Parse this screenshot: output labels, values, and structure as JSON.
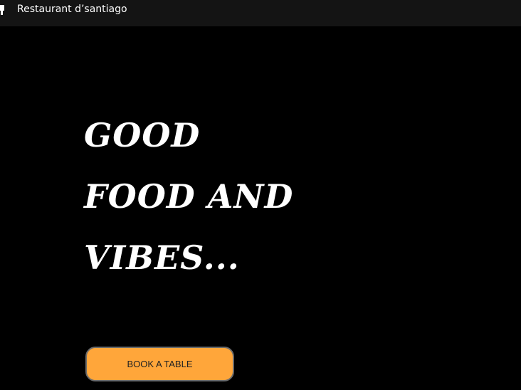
{
  "window": {
    "title": "Restaurant d’santiago",
    "icon": "chef-hat-icon"
  },
  "hero": {
    "headline_lines": [
      "GOOD",
      "FOOD AND",
      "VIBES..."
    ],
    "cta_label": "BOOK A TABLE"
  },
  "colors": {
    "background": "#000000",
    "titlebar": "#141414",
    "headline": "#ffffff",
    "button": "#ffa63a"
  }
}
